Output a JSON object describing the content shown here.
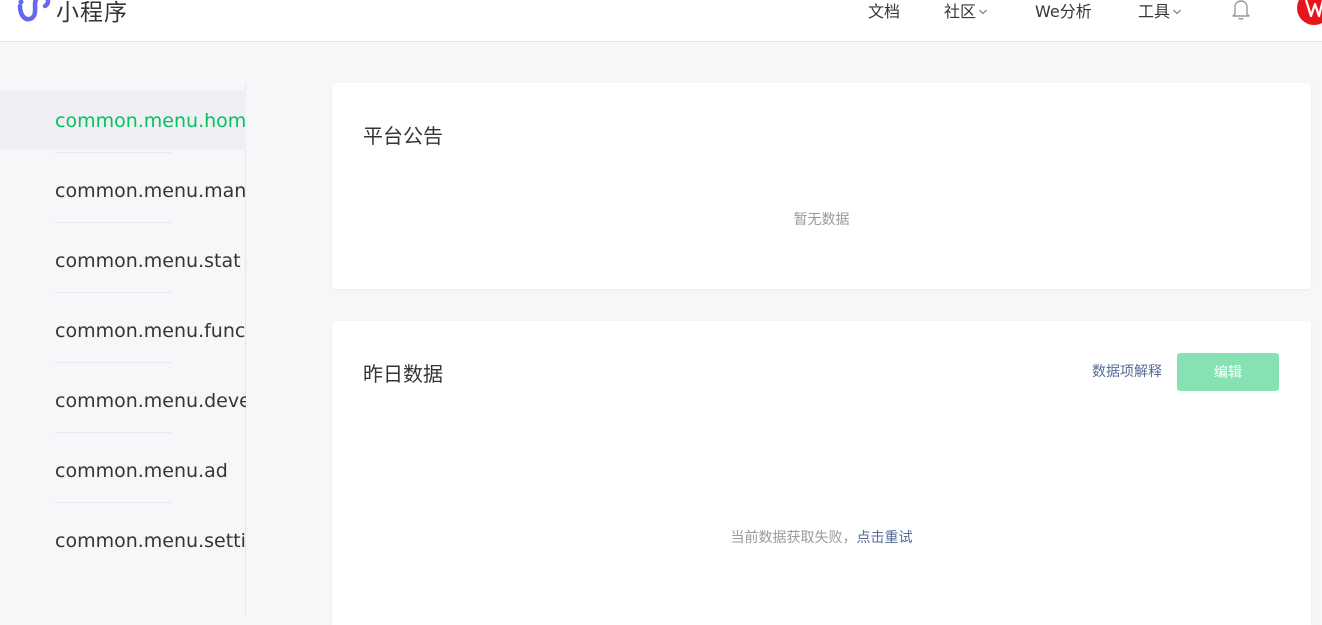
{
  "header": {
    "brand": "小程序",
    "nav": [
      {
        "label": "文档",
        "has_dropdown": false
      },
      {
        "label": "社区",
        "has_dropdown": true
      },
      {
        "label": "We分析",
        "has_dropdown": false
      },
      {
        "label": "工具",
        "has_dropdown": true
      }
    ],
    "bell_icon": "bell-icon",
    "avatar_icon": "avatar-icon"
  },
  "sidebar": {
    "items": [
      {
        "label": "common.menu.home",
        "active": true
      },
      {
        "label": "common.menu.manage",
        "active": false
      },
      {
        "label": "common.menu.stat",
        "active": false
      },
      {
        "label": "common.menu.func",
        "active": false
      },
      {
        "label": "common.menu.develop",
        "active": false
      },
      {
        "label": "common.menu.ad",
        "active": false
      },
      {
        "label": "common.menu.setting",
        "active": false
      }
    ]
  },
  "announcement": {
    "title": "平台公告",
    "empty_text": "暂无数据"
  },
  "yesterday": {
    "title": "昨日数据",
    "explain_link": "数据项解释",
    "edit_button": "编辑",
    "error_text": "当前数据获取失败，",
    "retry_link": "点击重试"
  },
  "colors": {
    "accent": "#07c160",
    "link": "#576b95",
    "edit_button_bg": "#86e2b2",
    "brand_logo": "#6467f0"
  }
}
